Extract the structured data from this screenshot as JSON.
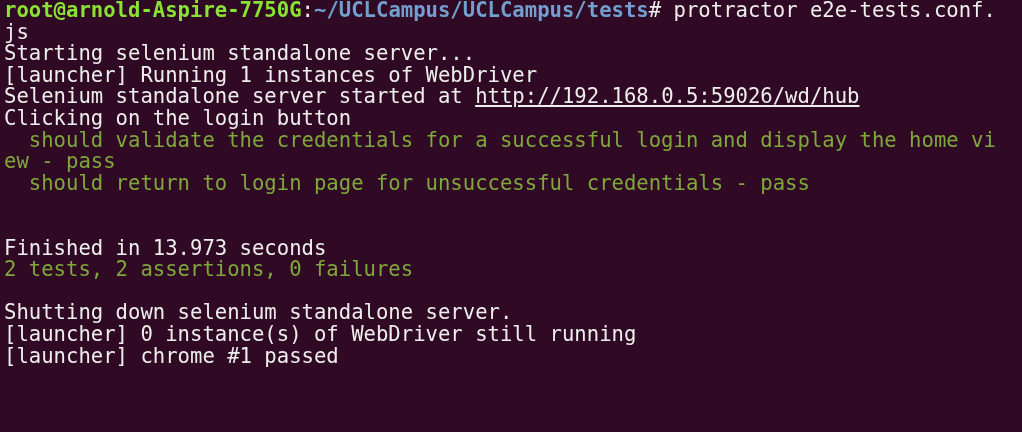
{
  "terminal": {
    "lines": [
      {
        "kind": "prompt",
        "user_host": "root@arnold-Aspire-7750G",
        "separator": ":",
        "path": "~/UCLCampus/UCLCampus/tests",
        "command": "# protractor e2e-tests.conf."
      },
      {
        "kind": "output",
        "text": "js"
      },
      {
        "kind": "output",
        "text": "Starting selenium standalone server..."
      },
      {
        "kind": "output",
        "text": "[launcher] Running 1 instances of WebDriver"
      },
      {
        "kind": "link",
        "text": "Selenium standalone server started at ",
        "link": "http://192.168.0.5:59026/wd/hub"
      },
      {
        "kind": "output",
        "text": "Clicking on the login button"
      },
      {
        "kind": "success",
        "text": "  should validate the credentials for a successful login and display the home vi"
      },
      {
        "kind": "success",
        "text": "ew - pass"
      },
      {
        "kind": "success",
        "text": "  should return to login page for unsuccessful credentials - pass"
      },
      {
        "kind": "blank"
      },
      {
        "kind": "blank"
      },
      {
        "kind": "output",
        "text": "Finished in 13.973 seconds"
      },
      {
        "kind": "success",
        "text": "2 tests, 2 assertions, 0 failures"
      },
      {
        "kind": "blank"
      },
      {
        "kind": "output",
        "text": "Shutting down selenium standalone server."
      },
      {
        "kind": "output",
        "text": "[launcher] 0 instance(s) of WebDriver still running"
      },
      {
        "kind": "output",
        "text": "[launcher] chrome #1 passed"
      }
    ]
  }
}
